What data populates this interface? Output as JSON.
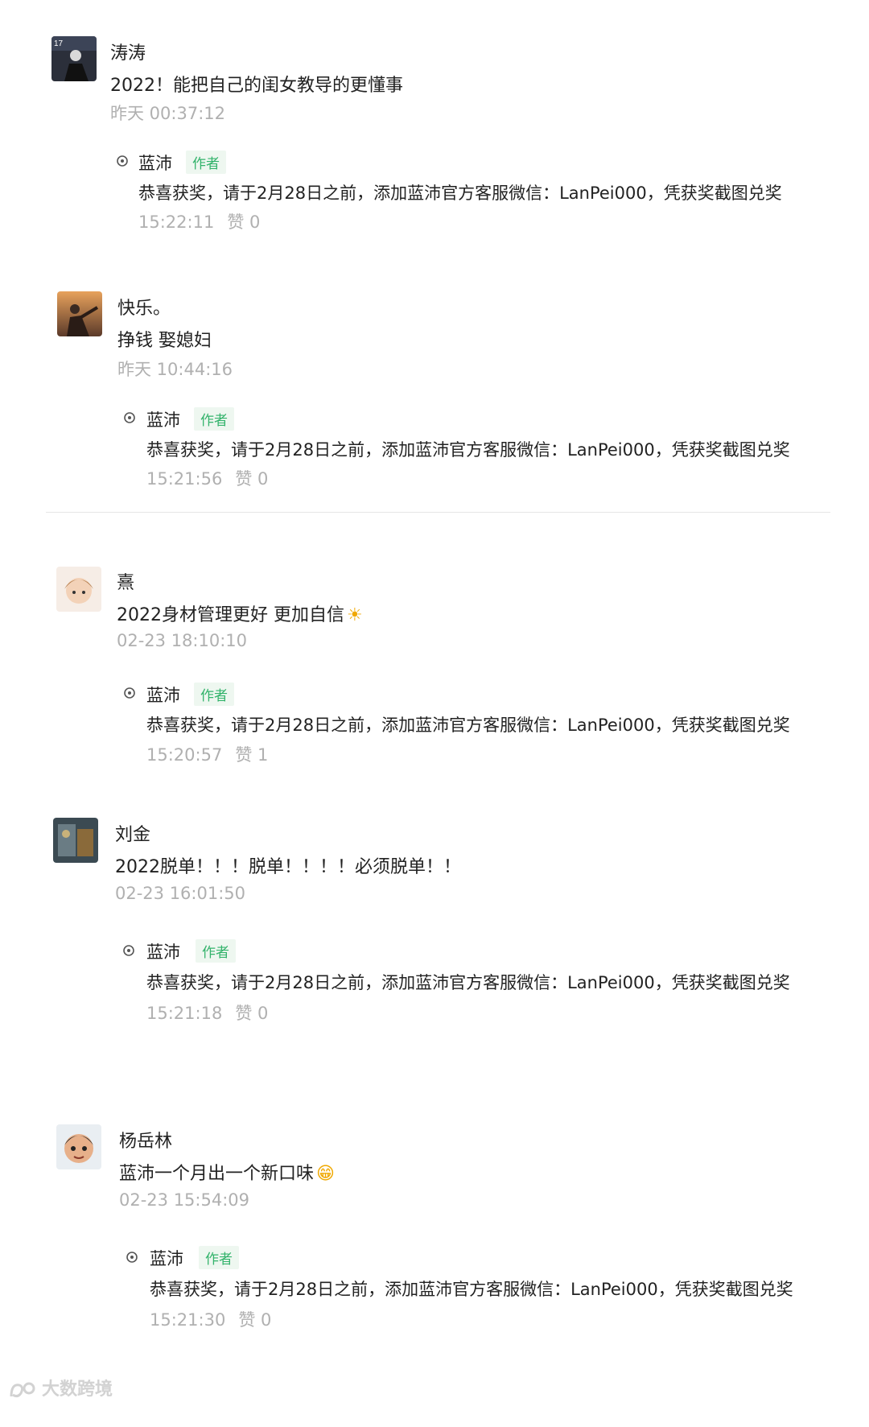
{
  "comments": [
    {
      "name": "涛涛",
      "text": "2022！能把自己的闺女教导的更懂事",
      "time": "昨天 00:37:12",
      "reply": {
        "name": "蓝沛",
        "badge": "作者",
        "text": "恭喜获奖，请于2月28日之前，添加蓝沛官方客服微信：LanPei000，凭获奖截图兑奖",
        "time": "15:22:11",
        "likes": "赞 0"
      }
    },
    {
      "name": "快乐。",
      "text": "挣钱 娶媳妇",
      "time": "昨天 10:44:16",
      "reply": {
        "name": "蓝沛",
        "badge": "作者",
        "text": "恭喜获奖，请于2月28日之前，添加蓝沛官方客服微信：LanPei000，凭获奖截图兑奖",
        "time": "15:21:56",
        "likes": "赞 0"
      }
    },
    {
      "name": "熹",
      "text": "2022身材管理更好 更加自信",
      "emoji": "☀",
      "time": "02-23 18:10:10",
      "reply": {
        "name": "蓝沛",
        "badge": "作者",
        "text": "恭喜获奖，请于2月28日之前，添加蓝沛官方客服微信：LanPei000，凭获奖截图兑奖",
        "time": "15:20:57",
        "likes": "赞 1"
      }
    },
    {
      "name": "刘金",
      "text": "2022脱单！！！脱单！！！！必须脱单！！",
      "time": "02-23 16:01:50",
      "reply": {
        "name": "蓝沛",
        "badge": "作者",
        "text": "恭喜获奖，请于2月28日之前，添加蓝沛官方客服微信：LanPei000，凭获奖截图兑奖",
        "time": "15:21:18",
        "likes": "赞 0"
      }
    },
    {
      "name": "杨岳林",
      "text": "蓝沛一个月出一个新口味",
      "emoji": "😁",
      "time": "02-23 15:54:09",
      "reply": {
        "name": "蓝沛",
        "badge": "作者",
        "text": "恭喜获奖，请于2月28日之前，添加蓝沛官方客服微信：LanPei000，凭获奖截图兑奖",
        "time": "15:21:30",
        "likes": "赞 0"
      }
    }
  ],
  "watermark": "大数跨境",
  "colors": {
    "badge_text": "#33b36b",
    "time_text": "#b0b0b0"
  }
}
